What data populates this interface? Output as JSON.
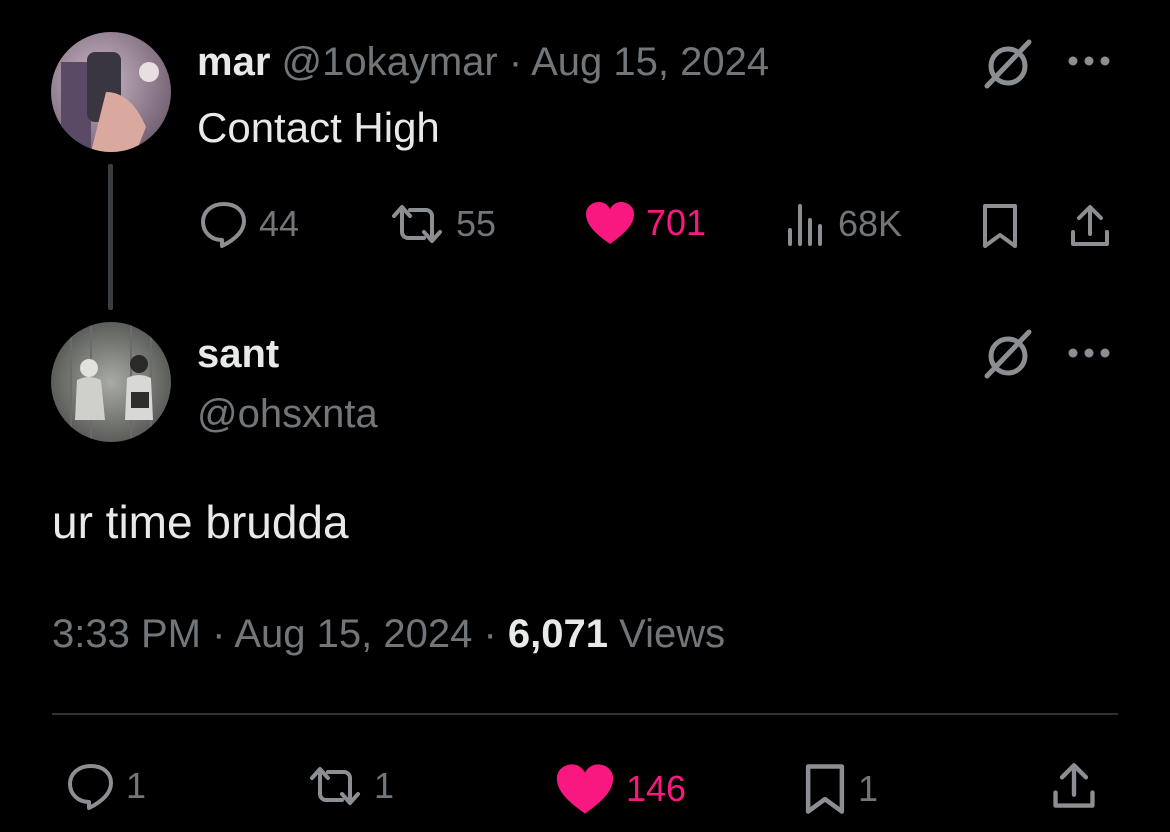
{
  "parent_tweet": {
    "author_name": "mar",
    "author_handle": "@1okaymar",
    "separator": "·",
    "date": "Aug 15, 2024",
    "text": "Contact High",
    "replies": "44",
    "reposts": "55",
    "likes": "701",
    "views": "68K",
    "icons": [
      "grok-icon",
      "more-icon",
      "reply-icon",
      "repost-icon",
      "like-icon",
      "views-icon",
      "bookmark-icon",
      "share-icon"
    ]
  },
  "main_tweet": {
    "author_name": "sant",
    "author_handle": "@ohsxnta",
    "text": "ur time brudda",
    "time": "3:33 PM",
    "sep1": "·",
    "date": "Aug 15, 2024",
    "sep2": "·",
    "views_count": "6,071",
    "views_label": "Views",
    "replies": "1",
    "reposts": "1",
    "likes": "146",
    "bookmarks": "1"
  },
  "colors": {
    "background": "#000000",
    "text": "#e7e9ea",
    "muted": "#71767b",
    "like": "#f91880",
    "divider": "#2f3336"
  }
}
